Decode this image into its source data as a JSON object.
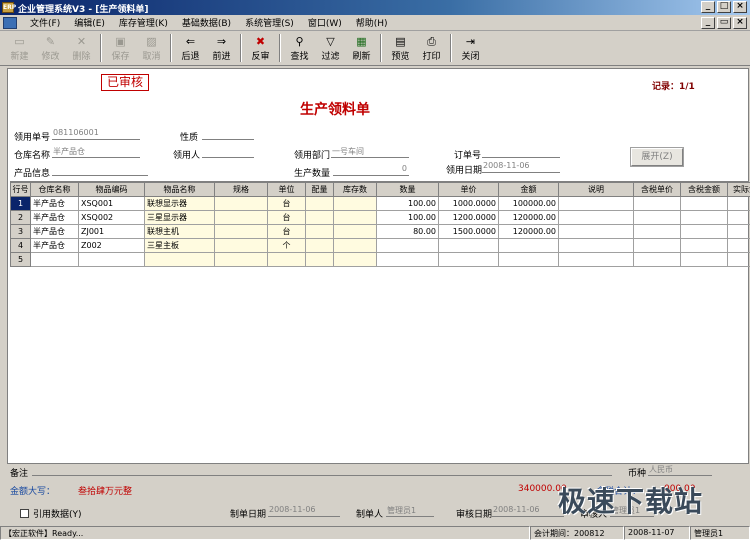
{
  "window": {
    "title": "企业管理系统V3 - [生产领料单]"
  },
  "menu": [
    "文件(F)",
    "编辑(E)",
    "库存管理(K)",
    "基础数据(B)",
    "系统管理(S)",
    "窗口(W)",
    "帮助(H)"
  ],
  "toolbar": [
    {
      "label": "新建",
      "icon": "new-icon",
      "glyph": "▭",
      "enabled": false
    },
    {
      "label": "修改",
      "icon": "edit-icon",
      "glyph": "✎",
      "enabled": false
    },
    {
      "label": "删除",
      "icon": "delete-icon",
      "glyph": "✕",
      "enabled": false
    },
    {
      "label": "保存",
      "icon": "save-icon",
      "glyph": "▣",
      "enabled": false
    },
    {
      "label": "取消",
      "icon": "cancel-icon",
      "glyph": "▨",
      "enabled": false
    },
    {
      "label": "后退",
      "icon": "back-icon",
      "glyph": "⇐",
      "enabled": true
    },
    {
      "label": "前进",
      "icon": "forward-icon",
      "glyph": "⇒",
      "enabled": true
    },
    {
      "label": "反审",
      "icon": "unapprove-icon",
      "glyph": "✖",
      "enabled": true
    },
    {
      "label": "查找",
      "icon": "find-icon",
      "glyph": "⚲",
      "enabled": true
    },
    {
      "label": "过滤",
      "icon": "filter-icon",
      "glyph": "▽",
      "enabled": true
    },
    {
      "label": "刷新",
      "icon": "refresh-icon",
      "glyph": "▦",
      "enabled": true
    },
    {
      "label": "预览",
      "icon": "preview-icon",
      "glyph": "▤",
      "enabled": true
    },
    {
      "label": "打印",
      "icon": "print-icon",
      "glyph": "⎙",
      "enabled": true
    },
    {
      "label": "关闭",
      "icon": "close-icon",
      "glyph": "⇥",
      "enabled": true
    }
  ],
  "form": {
    "stamp": "已审核",
    "title": "生产领料单",
    "record_info": "记录：1/1",
    "fields": {
      "doc_no": {
        "label": "领用单号",
        "value": "081106001"
      },
      "nature": {
        "label": "性质",
        "value": ""
      },
      "warehouse": {
        "label": "仓库名称",
        "value": "半产品仓"
      },
      "user": {
        "label": "领用人",
        "value": ""
      },
      "dept": {
        "label": "领用部门",
        "value": "一号车间"
      },
      "order_no": {
        "label": "订单号",
        "value": ""
      },
      "product_info": {
        "label": "产品信息",
        "value": ""
      },
      "prod_qty": {
        "label": "生产数量",
        "value": "0"
      },
      "date": {
        "label": "领用日期",
        "value": "2008-11-06"
      }
    },
    "expand_button": "展开(Z)"
  },
  "grid": {
    "columns": [
      "行号",
      "仓库名称",
      "物品编码",
      "物品名称",
      "规格",
      "单位",
      "配量",
      "库存数",
      "数量",
      "单价",
      "金额",
      "说明",
      "含税单价",
      "含税金额",
      "实际金"
    ],
    "rows": [
      [
        "1",
        "半产品仓",
        "XSQ001",
        "联想显示器",
        "",
        "台",
        "",
        "",
        "100.00",
        "1000.0000",
        "100000.00",
        "",
        "",
        "",
        ""
      ],
      [
        "2",
        "半产品仓",
        "XSQ002",
        "三星显示器",
        "",
        "台",
        "",
        "",
        "100.00",
        "1200.0000",
        "120000.00",
        "",
        "",
        "",
        ""
      ],
      [
        "3",
        "半产品仓",
        "ZJ001",
        "联想主机",
        "",
        "台",
        "",
        "",
        "80.00",
        "1500.0000",
        "120000.00",
        "",
        "",
        "",
        ""
      ],
      [
        "4",
        "半产品仓",
        "Z002",
        "三星主板",
        "",
        "个",
        "",
        "",
        "",
        "",
        "",
        "",
        "",
        "",
        ""
      ],
      [
        "5",
        "",
        "",
        "",
        "",
        "",
        "",
        "",
        "",
        "",
        "",
        "",
        "",
        "",
        ""
      ]
    ]
  },
  "bottom": {
    "remark_label": "备注",
    "currency_label": "币种",
    "currency_value": "人民币",
    "amount_upper_label": "金额大写：",
    "amount_upper_value": "叁拾肆万元整",
    "total_amount": "340000.00",
    "tax_total_label": "含税合计：",
    "tax_total_value": "000.00",
    "quote_checkbox_label": "引用数据(Y)",
    "created_date_label": "制单日期",
    "created_date_value": "2008-11-06",
    "creator_label": "制单人",
    "creator_value": "管理员1",
    "audit_date_label": "审核日期",
    "audit_date_value": "2008-11-06",
    "auditor_label": "审核人",
    "auditor_value": "管理员1"
  },
  "status": {
    "company": "【宏正软件】Ready...",
    "period_label": "会计期间：200812",
    "date": "2008-11-07",
    "user": "管理员1"
  },
  "watermark": "极速下载站"
}
